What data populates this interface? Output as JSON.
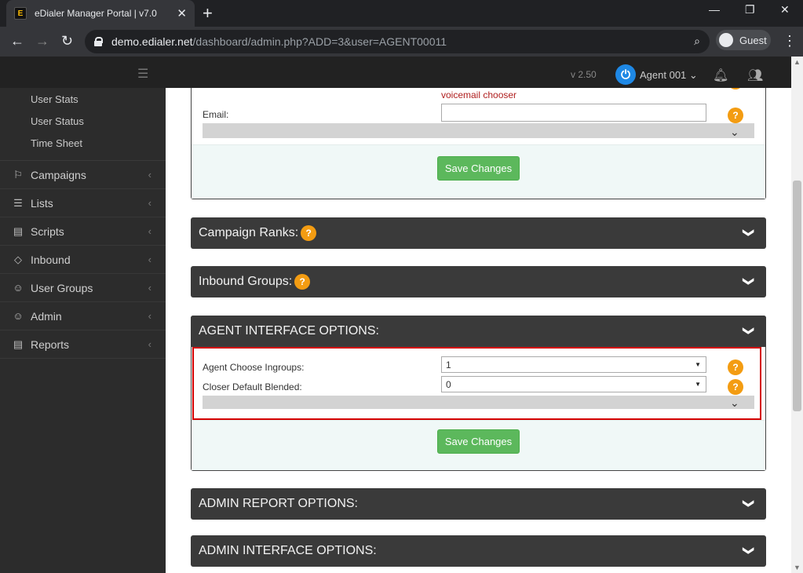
{
  "browser": {
    "tab_title": "eDialer Manager Portal | v7.0",
    "tab_favicon": "E",
    "tab_close": "✕",
    "new_tab": "+",
    "win_min": "—",
    "win_max": "❐",
    "win_close": "✕",
    "url_host": "demo.edialer.net",
    "url_path": "/dashboard/admin.php?ADD=3&user=AGENT00011",
    "profile": "Guest"
  },
  "header": {
    "version": "v 2.50",
    "agent_logo": "⏻",
    "agent_name": "Agent 001 ⌄"
  },
  "sidebar": {
    "sub_items": [
      "User Stats",
      "User Status",
      "Time Sheet"
    ],
    "menu": [
      {
        "label": "Campaigns",
        "icon": "flag-icon",
        "glyph": "⚐"
      },
      {
        "label": "Lists",
        "icon": "list-icon",
        "glyph": "☰"
      },
      {
        "label": "Scripts",
        "icon": "script-icon",
        "glyph": "▤"
      },
      {
        "label": "Inbound",
        "icon": "diamond-icon",
        "glyph": "◇"
      },
      {
        "label": "User Groups",
        "icon": "user-icon",
        "glyph": "☺"
      },
      {
        "label": "Admin",
        "icon": "admin-icon",
        "glyph": "☺"
      },
      {
        "label": "Reports",
        "icon": "report-icon",
        "glyph": "▤"
      }
    ],
    "chevron": "‹"
  },
  "main": {
    "voicemail_chooser": "voicemail chooser",
    "email_label": "Email:",
    "email_value": "",
    "help_glyph": "?",
    "save_label": "Save Changes",
    "panels": {
      "campaign_ranks": "Campaign Ranks:",
      "inbound_groups": "Inbound Groups:",
      "agent_interface": "AGENT INTERFACE OPTIONS:",
      "admin_report": "ADMIN REPORT OPTIONS:",
      "admin_interface": "ADMIN INTERFACE OPTIONS:"
    },
    "agent_fields": [
      {
        "label": "Agent Choose Ingroups:",
        "value": "1"
      },
      {
        "label": "Closer Default Blended:",
        "value": "0"
      }
    ],
    "chevron_glyph": "❯"
  },
  "colors": {
    "accent_help": "#f39c12",
    "save_button": "#5cb85c",
    "highlight_border": "#d40000",
    "panel_head": "#3a3a3a"
  }
}
